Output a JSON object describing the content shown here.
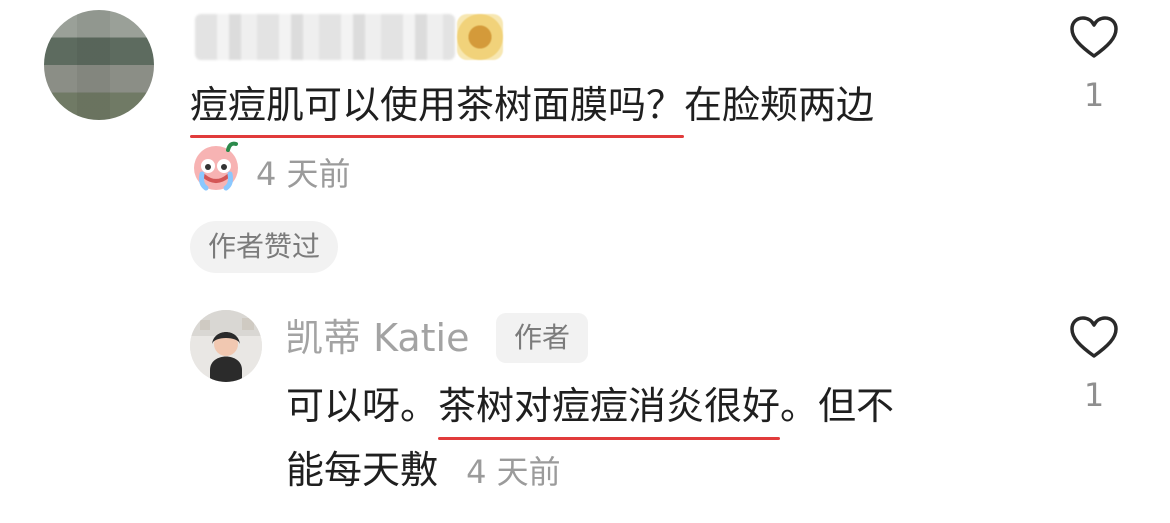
{
  "comment": {
    "text_underlined": "痘痘肌可以使用茶树面膜吗？",
    "text_rest": "在脸颊两边",
    "time": "4 天前",
    "author_liked_label": "作者赞过",
    "like_count": "1",
    "icons": {
      "avatar": "avatar",
      "emoji": "crying-emoji-icon",
      "like": "heart-outline-icon"
    }
  },
  "reply": {
    "author_name": "凯蒂 Katie",
    "author_tag": "作者",
    "line1_before": "可以呀。",
    "line1_underlined": "茶树对痘痘消炎很好",
    "line1_after": "。但不",
    "line2": "能每天敷",
    "time": "4 天前",
    "like_count": "1",
    "icons": {
      "avatar": "avatar",
      "like": "heart-outline-icon"
    }
  },
  "colors": {
    "underline": "#e13b3b",
    "muted_text": "#9b9b9b",
    "pill_bg": "#f2f2f2"
  }
}
